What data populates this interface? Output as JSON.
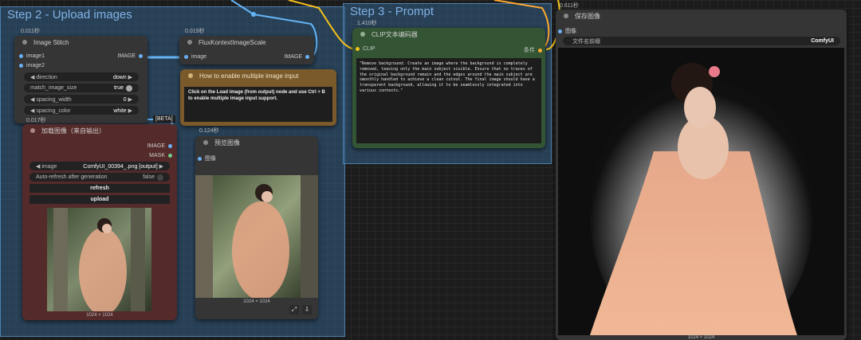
{
  "groups": {
    "step2_title": "Step 2 - Upload images",
    "step3_title": "Step 3 - Prompt"
  },
  "image_stitch": {
    "time": "0.011秒",
    "title": "Image Stitch",
    "input_image1": "image1",
    "input_image2": "image2",
    "output": "IMAGE",
    "direction_label": "direction",
    "direction_value": "down",
    "match_label": "match_image_size",
    "match_value": "true",
    "spacing_width_label": "spacing_width",
    "spacing_width_value": "0",
    "spacing_color_label": "spacing_color",
    "spacing_color_value": "white",
    "beta": "[BETA]"
  },
  "flux_scale": {
    "time": "0.019秒",
    "title": "FluxKontextImageScale",
    "input": "image",
    "output": "IMAGE"
  },
  "note": {
    "title": "How to enable multiple image input",
    "text": "Click on the Load image (from output) node and use Ctrl + B to enable multiple image input support."
  },
  "load_image": {
    "time": "0.017秒",
    "title": "加载图像（来自输出）",
    "out_image": "IMAGE",
    "out_mask": "MASK",
    "image_label": "image",
    "image_value": "ComfyUI_00394_.png [output]",
    "auto_label": "Auto-refresh after generation",
    "auto_value": "false",
    "refresh": "refresh",
    "upload": "upload",
    "dims": "1024 × 1024"
  },
  "preview": {
    "time": "0.124秒",
    "title": "预览图像",
    "input": "图像",
    "dims": "1024 × 1024"
  },
  "clip": {
    "time": "1.410秒",
    "title": "CLIP文本编码器",
    "input": "CLIP",
    "output": "条件",
    "prompt": "\"Remove background: Create an image where the background is completely removed, leaving only the main subject visible. Ensure that no traces of the original background remain and the edges around the main subject are smoothly handled to achieve a clean cutout. The final image should have a transparent background, allowing it to be seamlessly integrated into various contexts.\""
  },
  "save": {
    "time": "0.611秒",
    "title": "保存图像",
    "input": "图像",
    "prefix_label": "文件名前缀",
    "prefix_value": "ComfyUI",
    "dims": "1024 × 1024"
  },
  "colors": {
    "group_bg": "#335f87",
    "group_title": "#7fb2e6",
    "clip_node": "#335533",
    "load_node": "#552a2a",
    "note_node": "#7a5a2a",
    "wire_clip": "#f5c21b",
    "wire_cond": "#ffa931",
    "wire_image": "#64b5f6"
  }
}
